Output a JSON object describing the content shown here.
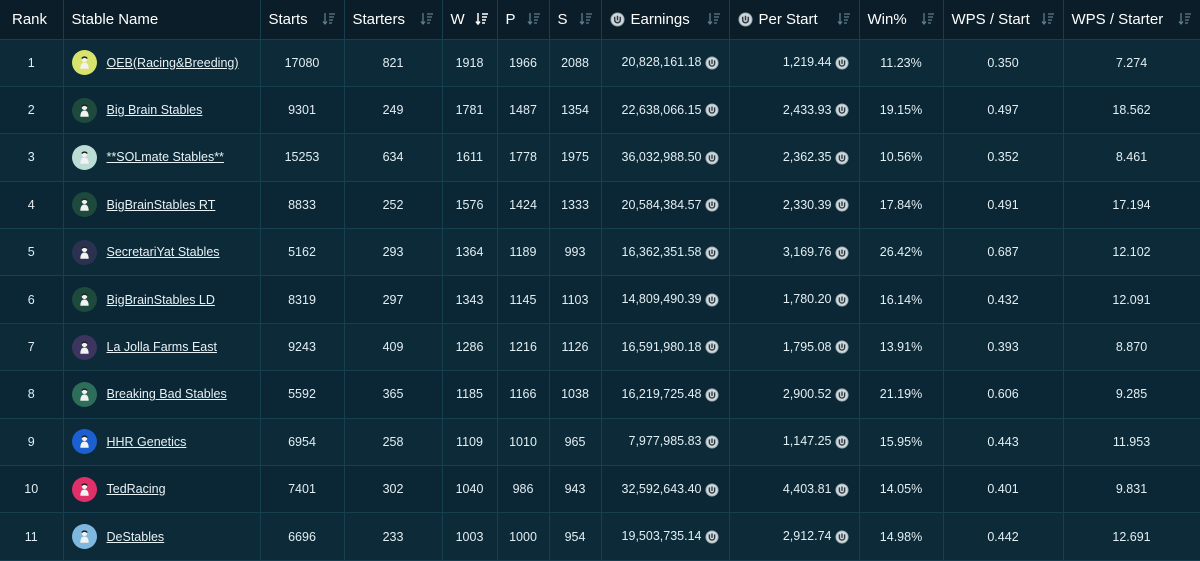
{
  "columns": [
    {
      "key": "rank",
      "label": "Rank",
      "sort": false
    },
    {
      "key": "name",
      "label": "Stable Name",
      "sort": false
    },
    {
      "key": "starts",
      "label": "Starts",
      "sort": true
    },
    {
      "key": "starters",
      "label": "Starters",
      "sort": true
    },
    {
      "key": "w",
      "label": "W",
      "sort": true,
      "active": true
    },
    {
      "key": "p",
      "label": "P",
      "sort": true
    },
    {
      "key": "s",
      "label": "S",
      "sort": true
    },
    {
      "key": "earnings",
      "label": "Earnings",
      "sort": true,
      "coin": true
    },
    {
      "key": "per_start",
      "label": "Per Start",
      "sort": true,
      "coin": true
    },
    {
      "key": "win_pct",
      "label": "Win%",
      "sort": true
    },
    {
      "key": "wps_start",
      "label": "WPS / Start",
      "sort": true
    },
    {
      "key": "wps_starter",
      "label": "WPS / Starter",
      "sort": true
    }
  ],
  "rows": [
    {
      "rank": "1",
      "name": "OEB(Racing&Breeding)",
      "avatar_color": "#d7e36a",
      "avatar_icon": "jockey-silks-icon",
      "starts": "17080",
      "starters": "821",
      "w": "1918",
      "p": "1966",
      "s": "2088",
      "earnings": "20,828,161.18",
      "per_start": "1,219.44",
      "win_pct": "11.23%",
      "wps_start": "0.350",
      "wps_starter": "7.274"
    },
    {
      "rank": "2",
      "name": "Big Brain Stables",
      "avatar_color": "#1d4a3c",
      "avatar_icon": "jockey-silks-icon",
      "starts": "9301",
      "starters": "249",
      "w": "1781",
      "p": "1487",
      "s": "1354",
      "earnings": "22,638,066.15",
      "per_start": "2,433.93",
      "win_pct": "19.15%",
      "wps_start": "0.497",
      "wps_starter": "18.562"
    },
    {
      "rank": "3",
      "name": "**SOLmate Stables**",
      "avatar_color": "#bcdcd6",
      "avatar_icon": "jockey-silks-icon",
      "starts": "15253",
      "starters": "634",
      "w": "1611",
      "p": "1778",
      "s": "1975",
      "earnings": "36,032,988.50",
      "per_start": "2,362.35",
      "win_pct": "10.56%",
      "wps_start": "0.352",
      "wps_starter": "8.461"
    },
    {
      "rank": "4",
      "name": "BigBrainStables RT",
      "avatar_color": "#1d4a3c",
      "avatar_icon": "jockey-silks-icon",
      "starts": "8833",
      "starters": "252",
      "w": "1576",
      "p": "1424",
      "s": "1333",
      "earnings": "20,584,384.57",
      "per_start": "2,330.39",
      "win_pct": "17.84%",
      "wps_start": "0.491",
      "wps_starter": "17.194"
    },
    {
      "rank": "5",
      "name": "SecretariYat Stables",
      "avatar_color": "#2a3250",
      "avatar_icon": "jockey-silks-icon",
      "starts": "5162",
      "starters": "293",
      "w": "1364",
      "p": "1189",
      "s": "993",
      "earnings": "16,362,351.58",
      "per_start": "3,169.76",
      "win_pct": "26.42%",
      "wps_start": "0.687",
      "wps_starter": "12.102"
    },
    {
      "rank": "6",
      "name": "BigBrainStables LD",
      "avatar_color": "#1d4a3c",
      "avatar_icon": "jockey-silks-icon",
      "starts": "8319",
      "starters": "297",
      "w": "1343",
      "p": "1145",
      "s": "1103",
      "earnings": "14,809,490.39",
      "per_start": "1,780.20",
      "win_pct": "16.14%",
      "wps_start": "0.432",
      "wps_starter": "12.091"
    },
    {
      "rank": "7",
      "name": "La Jolla Farms East",
      "avatar_color": "#3b3560",
      "avatar_icon": "jockey-silks-icon",
      "starts": "9243",
      "starters": "409",
      "w": "1286",
      "p": "1216",
      "s": "1126",
      "earnings": "16,591,980.18",
      "per_start": "1,795.08",
      "win_pct": "13.91%",
      "wps_start": "0.393",
      "wps_starter": "8.870"
    },
    {
      "rank": "8",
      "name": "Breaking Bad Stables",
      "avatar_color": "#2d6e5a",
      "avatar_icon": "jockey-silks-icon",
      "starts": "5592",
      "starters": "365",
      "w": "1185",
      "p": "1166",
      "s": "1038",
      "earnings": "16,219,725.48",
      "per_start": "2,900.52",
      "win_pct": "21.19%",
      "wps_start": "0.606",
      "wps_starter": "9.285"
    },
    {
      "rank": "9",
      "name": "HHR Genetics",
      "avatar_color": "#1b5fd0",
      "avatar_icon": "jockey-silks-icon",
      "starts": "6954",
      "starters": "258",
      "w": "1109",
      "p": "1010",
      "s": "965",
      "earnings": "7,977,985.83",
      "per_start": "1,147.25",
      "win_pct": "15.95%",
      "wps_start": "0.443",
      "wps_starter": "11.953"
    },
    {
      "rank": "10",
      "name": "TedRacing",
      "avatar_color": "#e0306a",
      "avatar_icon": "jockey-silks-icon",
      "starts": "7401",
      "starters": "302",
      "w": "1040",
      "p": "986",
      "s": "943",
      "earnings": "32,592,643.40",
      "per_start": "4,403.81",
      "win_pct": "14.05%",
      "wps_start": "0.401",
      "wps_starter": "9.831"
    },
    {
      "rank": "11",
      "name": "DeStables",
      "avatar_color": "#7fb8de",
      "avatar_icon": "jockey-silks-icon",
      "starts": "6696",
      "starters": "233",
      "w": "1003",
      "p": "1000",
      "s": "954",
      "earnings": "19,503,735.14",
      "per_start": "2,912.74",
      "win_pct": "14.98%",
      "wps_start": "0.442",
      "wps_starter": "12.691"
    }
  ]
}
